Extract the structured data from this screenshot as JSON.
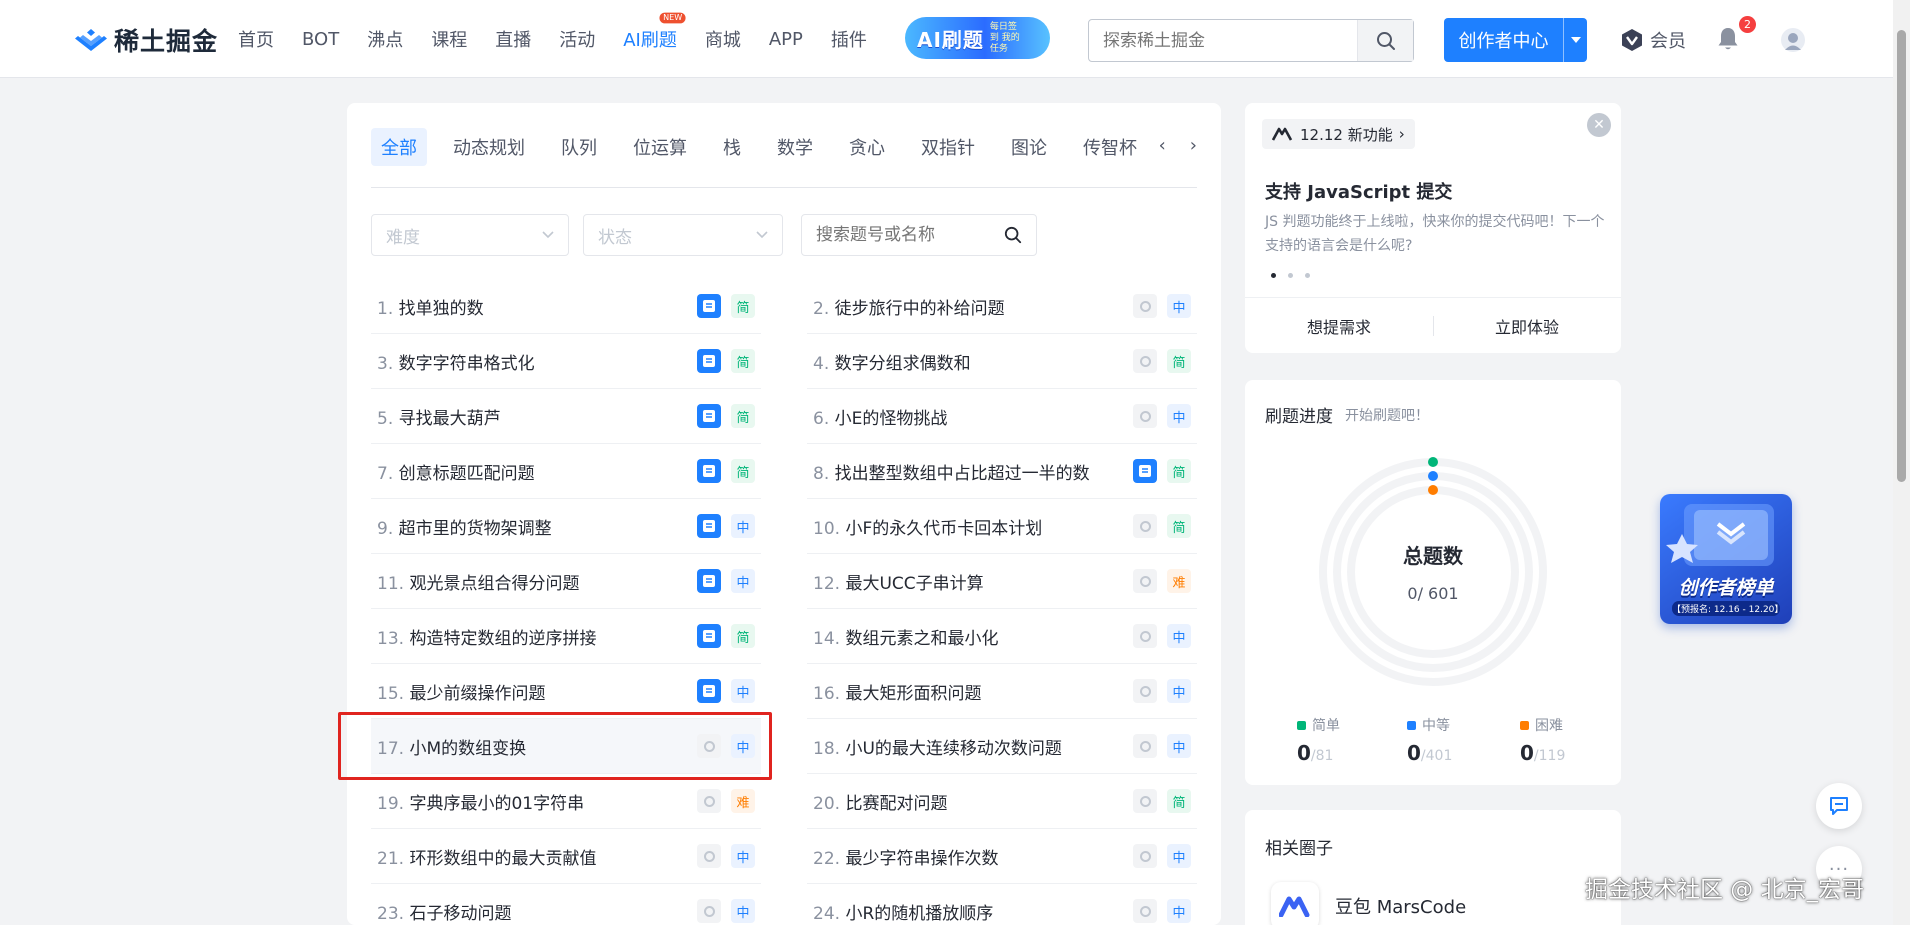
{
  "header": {
    "logo_text": "稀土掘金",
    "nav": [
      {
        "label": "首页",
        "active": false
      },
      {
        "label": "BOT",
        "active": false
      },
      {
        "label": "沸点",
        "active": false
      },
      {
        "label": "课程",
        "active": false
      },
      {
        "label": "直播",
        "active": false
      },
      {
        "label": "活动",
        "active": false
      },
      {
        "label": "AI刷题",
        "active": true,
        "badge": "NEW"
      },
      {
        "label": "商城",
        "active": false
      },
      {
        "label": "APP",
        "active": false
      },
      {
        "label": "插件",
        "active": false
      }
    ],
    "ai_banner": {
      "main": "AI刷题",
      "sub": "每日签到 我的任务"
    },
    "search_placeholder": "探索稀土掘金",
    "creator_label": "创作者中心",
    "vip_label": "会员",
    "notification_count": "2",
    "accent": "#1e80ff"
  },
  "main": {
    "tabs": [
      "全部",
      "动态规划",
      "队列",
      "位运算",
      "栈",
      "数学",
      "贪心",
      "双指针",
      "图论",
      "传智杯"
    ],
    "filters": {
      "difficulty_placeholder": "难度",
      "status_placeholder": "状态",
      "search_placeholder": "搜索题号或名称"
    },
    "problems": [
      {
        "num": "1.",
        "title": "找单独的数",
        "icon": "note",
        "difficulty": "简"
      },
      {
        "num": "2.",
        "title": "徒步旅行中的补给问题",
        "icon": "circle",
        "difficulty": "中"
      },
      {
        "num": "3.",
        "title": "数字字符串格式化",
        "icon": "note",
        "difficulty": "简"
      },
      {
        "num": "4.",
        "title": "数字分组求偶数和",
        "icon": "circle",
        "difficulty": "简"
      },
      {
        "num": "5.",
        "title": "寻找最大葫芦",
        "icon": "note",
        "difficulty": "简"
      },
      {
        "num": "6.",
        "title": "小E的怪物挑战",
        "icon": "circle",
        "difficulty": "中"
      },
      {
        "num": "7.",
        "title": "创意标题匹配问题",
        "icon": "note",
        "difficulty": "简"
      },
      {
        "num": "8.",
        "title": "找出整型数组中占比超过一半的数",
        "icon": "note",
        "difficulty": "简"
      },
      {
        "num": "9.",
        "title": "超市里的货物架调整",
        "icon": "note",
        "difficulty": "中"
      },
      {
        "num": "10.",
        "title": "小F的永久代币卡回本计划",
        "icon": "circle",
        "difficulty": "简"
      },
      {
        "num": "11.",
        "title": "观光景点组合得分问题",
        "icon": "note",
        "difficulty": "中"
      },
      {
        "num": "12.",
        "title": "最大UCC子串计算",
        "icon": "circle",
        "difficulty": "难"
      },
      {
        "num": "13.",
        "title": "构造特定数组的逆序拼接",
        "icon": "note",
        "difficulty": "简"
      },
      {
        "num": "14.",
        "title": "数组元素之和最小化",
        "icon": "circle",
        "difficulty": "中"
      },
      {
        "num": "15.",
        "title": "最少前缀操作问题",
        "icon": "note",
        "difficulty": "中"
      },
      {
        "num": "16.",
        "title": "最大矩形面积问题",
        "icon": "circle",
        "difficulty": "中"
      },
      {
        "num": "17.",
        "title": "小M的数组变换",
        "icon": "circle",
        "difficulty": "中",
        "highlight": true
      },
      {
        "num": "18.",
        "title": "小U的最大连续移动次数问题",
        "icon": "circle",
        "difficulty": "中"
      },
      {
        "num": "19.",
        "title": "字典序最小的01字符串",
        "icon": "circle",
        "difficulty": "难"
      },
      {
        "num": "20.",
        "title": "比赛配对问题",
        "icon": "circle",
        "difficulty": "简"
      },
      {
        "num": "21.",
        "title": "环形数组中的最大贡献值",
        "icon": "circle",
        "difficulty": "中"
      },
      {
        "num": "22.",
        "title": "最少字符串操作次数",
        "icon": "circle",
        "difficulty": "中"
      },
      {
        "num": "23.",
        "title": "石子移动问题",
        "icon": "circle",
        "difficulty": "中"
      },
      {
        "num": "24.",
        "title": "小R的随机播放顺序",
        "icon": "circle",
        "difficulty": "中"
      }
    ]
  },
  "feature_card": {
    "pill": "12.12 新功能",
    "title": "支持 JavaScript 提交",
    "desc": "JS 判题功能终于上线啦，快来你的提交代码吧！下一个支持的语言会是什么呢?",
    "actions": [
      "想提需求",
      "立即体验"
    ]
  },
  "progress_card": {
    "title": "刷题进度",
    "subtitle": "开始刷题吧！",
    "ring_label": "总题数",
    "ring_value": "0/ 601",
    "stats": [
      {
        "label": "简单",
        "value": "0",
        "total": "/81",
        "color": "#00b578"
      },
      {
        "label": "中等",
        "value": "0",
        "total": "/401",
        "color": "#1e80ff"
      },
      {
        "label": "困难",
        "value": "0",
        "total": "/119",
        "color": "#ff7d00"
      }
    ]
  },
  "circle_card": {
    "title": "相关圈子",
    "item": "豆包 MarsCode"
  },
  "promo": {
    "title": "创作者榜单",
    "sub": "【预报名: 12.16 - 12.20】"
  },
  "watermark": "掘金技术社区 @ 北京_宏哥"
}
